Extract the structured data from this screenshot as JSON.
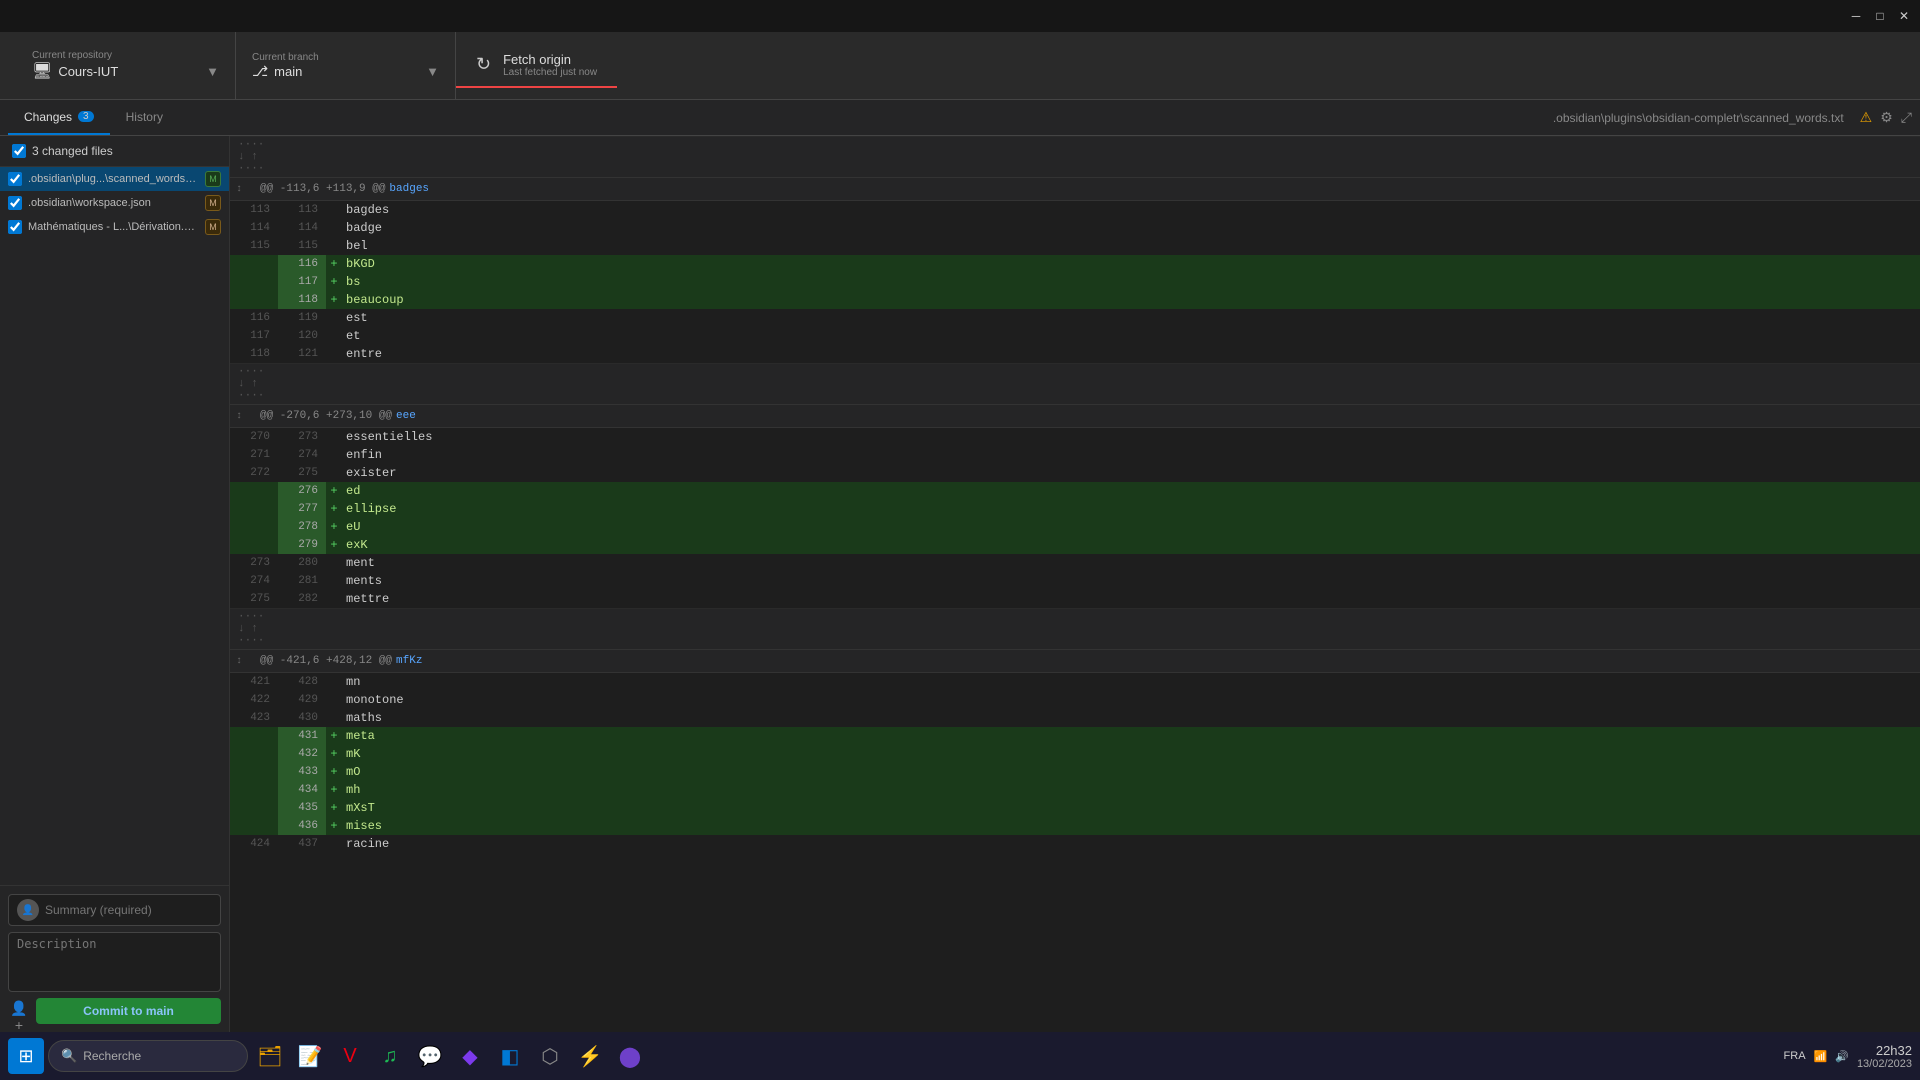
{
  "titlebar": {
    "minimize": "─",
    "maximize": "□",
    "close": "✕"
  },
  "toolbar": {
    "repo_label": "Current repository",
    "repo_name": "Cours-IUT",
    "branch_label": "Current branch",
    "branch_name": "main",
    "fetch_label": "Fetch origin",
    "fetch_sub": "Last fetched just now"
  },
  "tabs": {
    "changes_label": "Changes",
    "changes_count": "3",
    "history_label": "History"
  },
  "breadcrumb": {
    "path": ".obsidian\\plugins\\obsidian-completr\\scanned_words.txt"
  },
  "sidebar": {
    "changed_files_label": "3 changed files",
    "files": [
      {
        "path": ".obsidian\\plug...\\scanned_words.txt",
        "status": "modified",
        "badge": "M",
        "badge_type": "green",
        "active": true
      },
      {
        "path": ".obsidian\\workspace.json",
        "status": "modified",
        "badge": "M",
        "badge_type": "orange",
        "active": false
      },
      {
        "path": "Mathématiques - L...\\Dérivation.md",
        "status": "modified",
        "badge": "M",
        "badge_type": "orange",
        "active": false
      }
    ]
  },
  "commit": {
    "summary_placeholder": "Summary (required)",
    "description_placeholder": "Description",
    "button_label": "Commit to",
    "branch": "main"
  },
  "diff": {
    "hunks": [
      {
        "id": "hunk1",
        "header": "@@ -113,6 +113,9 @@ badges",
        "context": "badges",
        "lines": [
          {
            "old": "113",
            "new": "113",
            "type": "context",
            "content": "bagdes"
          },
          {
            "old": "114",
            "new": "114",
            "type": "context",
            "content": "badge"
          },
          {
            "old": "115",
            "new": "115",
            "type": "context",
            "content": "bel"
          },
          {
            "old": "",
            "new": "116",
            "type": "added",
            "content": "bKGD"
          },
          {
            "old": "",
            "new": "117",
            "type": "added",
            "content": "bs"
          },
          {
            "old": "",
            "new": "118",
            "type": "added",
            "content": "beaucoup"
          },
          {
            "old": "116",
            "new": "119",
            "type": "context",
            "content": "est"
          },
          {
            "old": "117",
            "new": "120",
            "type": "context",
            "content": "et"
          },
          {
            "old": "118",
            "new": "121",
            "type": "context",
            "content": "entre"
          }
        ]
      },
      {
        "id": "hunk2",
        "header": "@@ -270,6 +273,10 @@ eee",
        "context": "eee",
        "lines": [
          {
            "old": "270",
            "new": "273",
            "type": "context",
            "content": "essentielles"
          },
          {
            "old": "271",
            "new": "274",
            "type": "context",
            "content": "enfin"
          },
          {
            "old": "272",
            "new": "275",
            "type": "context",
            "content": "exister"
          },
          {
            "old": "",
            "new": "276",
            "type": "added",
            "content": "ed"
          },
          {
            "old": "",
            "new": "277",
            "type": "added",
            "content": "ellipse"
          },
          {
            "old": "",
            "new": "278",
            "type": "added",
            "content": "eU"
          },
          {
            "old": "",
            "new": "279",
            "type": "added",
            "content": "exK"
          },
          {
            "old": "273",
            "new": "280",
            "type": "context",
            "content": "ment"
          },
          {
            "old": "274",
            "new": "281",
            "type": "context",
            "content": "ments"
          },
          {
            "old": "275",
            "new": "282",
            "type": "context",
            "content": "mettre"
          }
        ]
      },
      {
        "id": "hunk3",
        "header": "@@ -421,6 +428,12 @@ mfKz",
        "context": "mfKz",
        "lines": [
          {
            "old": "421",
            "new": "428",
            "type": "context",
            "content": "mn"
          },
          {
            "old": "422",
            "new": "429",
            "type": "context",
            "content": "monotone"
          },
          {
            "old": "423",
            "new": "430",
            "type": "context",
            "content": "maths"
          },
          {
            "old": "",
            "new": "431",
            "type": "added",
            "content": "meta"
          },
          {
            "old": "",
            "new": "432",
            "type": "added",
            "content": "mK"
          },
          {
            "old": "",
            "new": "433",
            "type": "added",
            "content": "mO"
          },
          {
            "old": "",
            "new": "434",
            "type": "added",
            "content": "mh"
          },
          {
            "old": "",
            "new": "435",
            "type": "added",
            "content": "mXsT"
          },
          {
            "old": "",
            "new": "436",
            "type": "added",
            "content": "mises"
          },
          {
            "old": "424",
            "new": "437",
            "type": "context",
            "content": "racine"
          }
        ]
      }
    ]
  },
  "taskbar": {
    "search_placeholder": "Recherche",
    "apps": [
      {
        "name": "file-explorer",
        "icon": "🗂",
        "color": "#e8a000"
      },
      {
        "name": "sticky-notes",
        "icon": "📝",
        "color": "#f5e642"
      },
      {
        "name": "vivaldi",
        "icon": "V",
        "color": "#e01"
      },
      {
        "name": "spotify",
        "icon": "♫",
        "color": "#1db954"
      },
      {
        "name": "discord",
        "icon": "💬",
        "color": "#5865f2"
      },
      {
        "name": "obsidian",
        "icon": "◆",
        "color": "#7c3aed"
      },
      {
        "name": "vscode",
        "icon": "◧",
        "color": "#0078d4"
      },
      {
        "name": "unknown1",
        "icon": "⬡",
        "color": "#888"
      },
      {
        "name": "flash",
        "icon": "⚡",
        "color": "#e44"
      },
      {
        "name": "github-desktop",
        "icon": "⬤",
        "color": "#6e40c9"
      }
    ],
    "systray": {
      "time": "22h32",
      "date": "13/02/2023",
      "lang": "FRA"
    }
  }
}
